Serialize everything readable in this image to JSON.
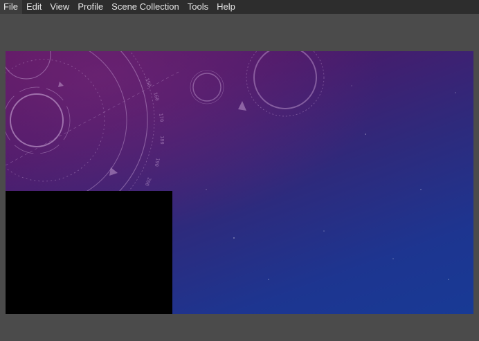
{
  "menubar": {
    "items": [
      {
        "label": "File"
      },
      {
        "label": "Edit"
      },
      {
        "label": "View"
      },
      {
        "label": "Profile"
      },
      {
        "label": "Scene Collection"
      },
      {
        "label": "Tools"
      },
      {
        "label": "Help"
      }
    ]
  },
  "preview": {
    "background": "space-hud-purple-blue",
    "dial_ticks": [
      "150",
      "160",
      "170",
      "180",
      "190",
      "200"
    ],
    "colors": {
      "top": "#5a1560",
      "bottom": "#183a95",
      "source_fill": "#000000"
    }
  }
}
